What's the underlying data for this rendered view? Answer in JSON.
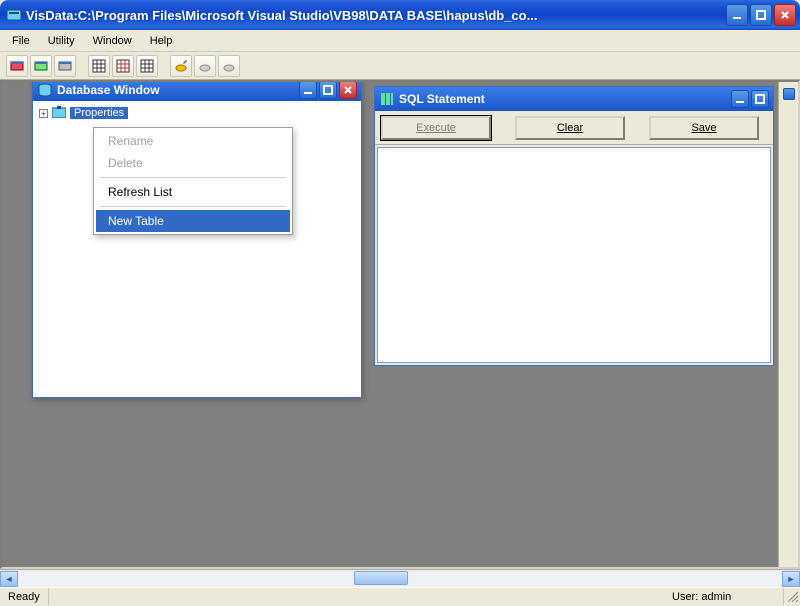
{
  "title": "VisData:C:\\Program Files\\Microsoft Visual Studio\\VB98\\DATA BASE\\hapus\\db_co...",
  "menubar": {
    "file": "File",
    "utility": "Utility",
    "window": "Window",
    "help": "Help"
  },
  "db_window": {
    "title": "Database Window",
    "selected_node": "Properties"
  },
  "sql_window": {
    "title": "SQL Statement",
    "execute_label": "Execute",
    "clear_label": "Clear",
    "save_label": "Save"
  },
  "context_menu": {
    "rename": "Rename",
    "delete": "Delete",
    "refresh": "Refresh List",
    "new_table": "New Table"
  },
  "status": {
    "ready": "Ready",
    "user": "User: admin"
  }
}
